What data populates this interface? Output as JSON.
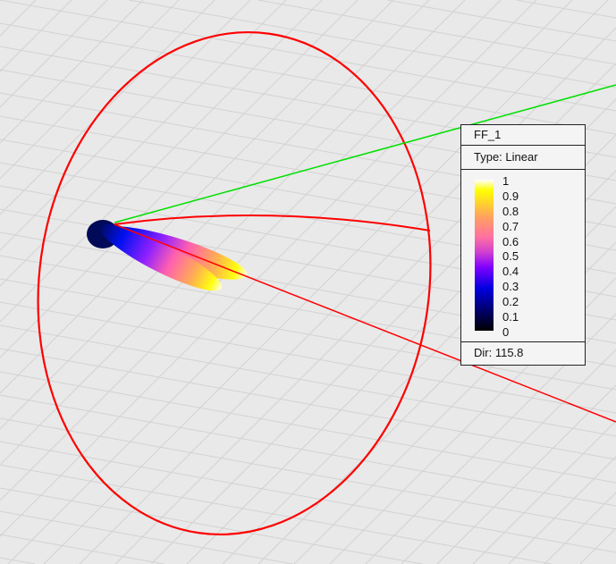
{
  "legend": {
    "title": "FF_1",
    "type": "Type: Linear",
    "ticks": [
      "1",
      "0.9",
      "0.8",
      "0.7",
      "0.6",
      "0.5",
      "0.4",
      "0.3",
      "0.2",
      "0.1",
      "0"
    ],
    "dir": "Dir: 115.8"
  },
  "colors": {
    "x_axis": "#ff0000",
    "y_axis": "#00e000",
    "grid": "#d2d2d2",
    "background": "#e9e9e9"
  }
}
